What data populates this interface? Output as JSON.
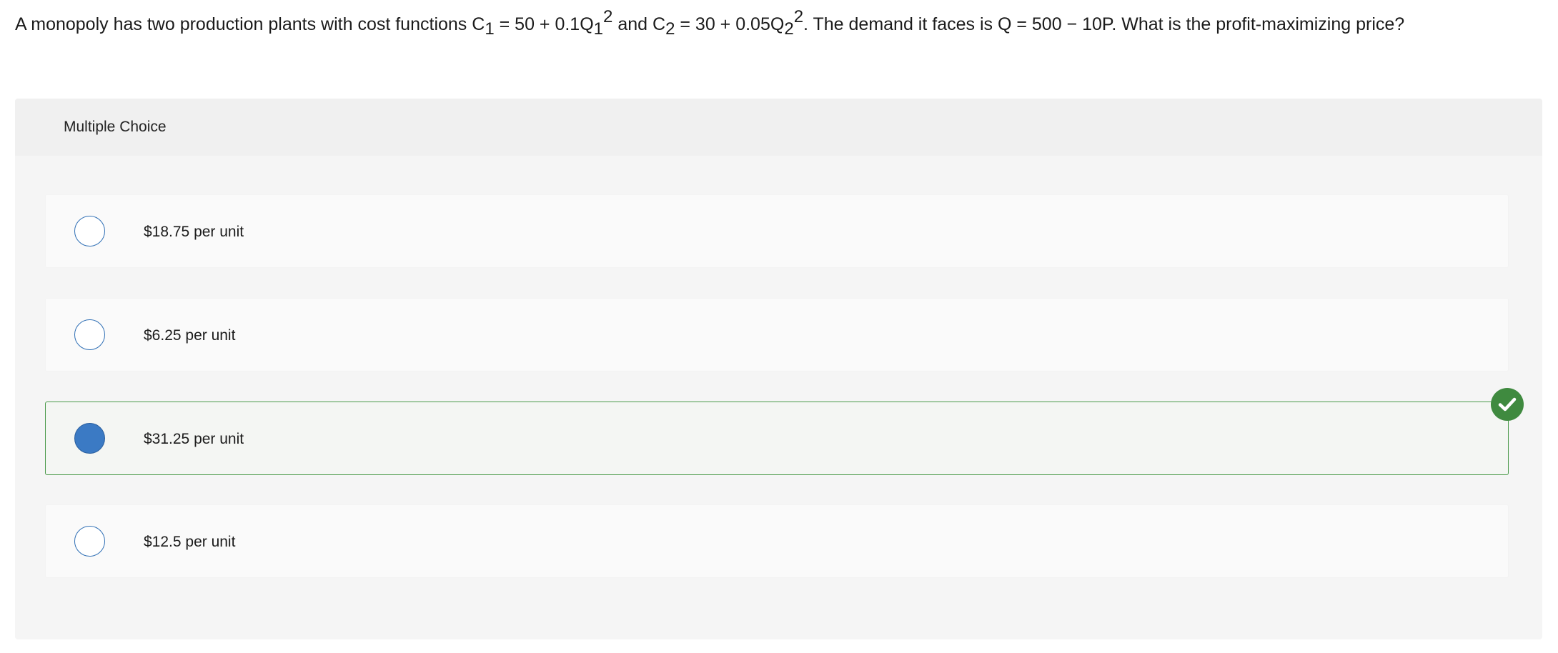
{
  "question": {
    "part1": "A monopoly has two production plants with cost functions C",
    "sub1": "1",
    "part2": " = 50 + 0.1Q",
    "sub2": "1",
    "sup2": "2",
    "part3": " and C",
    "sub3": "2",
    "part4": " = 30 + 0.05Q",
    "sub4": "2",
    "sup4": "2",
    "part5": ". The demand it faces is Q = 500 − 10P. What is the profit-maximizing price?"
  },
  "panel": {
    "header": "Multiple Choice"
  },
  "options": [
    {
      "label": "$18.75 per unit",
      "selected": false,
      "correct": false
    },
    {
      "label": "$6.25 per unit",
      "selected": false,
      "correct": false
    },
    {
      "label": "$31.25 per unit",
      "selected": true,
      "correct": true
    },
    {
      "label": "$12.5 per unit",
      "selected": false,
      "correct": false
    }
  ],
  "colors": {
    "radio_border": "#2f6fb5",
    "radio_selected": "#3b7ac4",
    "correct_border": "#4a9a4a",
    "check_badge": "#3f8a3f"
  },
  "icons": {
    "correct": "checkmark-circle-icon"
  }
}
